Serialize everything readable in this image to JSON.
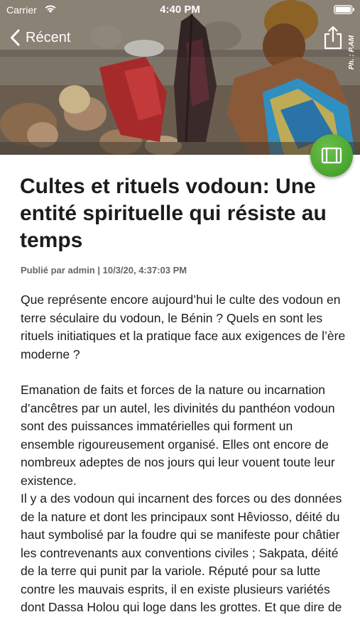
{
  "status_bar": {
    "carrier": "Carrier",
    "time": "4:40 PM",
    "icons": [
      "wifi-icon",
      "battery-icon"
    ]
  },
  "nav": {
    "back_label": "Récent",
    "back_icon": "chevron-left-icon",
    "share_icon": "share-icon"
  },
  "hero": {
    "photo_credit": "Ph. : P.AM",
    "fab_icon": "film-strip-icon",
    "fab_color": "#4ea832"
  },
  "article": {
    "title": "Cultes et rituels vodoun: Une entité spirituelle qui résiste au temps",
    "meta": "Publié par admin | 10/3/20, 4:37:03 PM",
    "paragraphs": [
      "Que représente encore aujourd’hui le culte des vodoun en terre séculaire du vodoun, le Bénin ? Quels en sont les rituels initiatiques et la pratique face aux exigences de l’ère moderne ?",
      "Emanation de faits et forces de la nature ou incarnation d’ancêtres par un autel, les divinités du panthéon vodoun sont des puissances immatérielles qui forment un ensemble rigoureusement organisé. Elles ont encore de nombreux adeptes de nos jours qui leur vouent toute leur existence.",
      "Il y a des vodoun qui incarnent des forces ou des données de la nature et dont les principaux sont Hêviosso, déité du haut symbolisé par la foudre qui se manifeste pour châtier les contrevenants aux conventions civiles ; Sakpata, déité de la terre qui punit par la variole. Réputé pour sa lutte contre les mauvais esprits, il en existe plusieurs variétés dont Dassa Holou qui loge dans les grottes. Et que dire de"
    ]
  }
}
